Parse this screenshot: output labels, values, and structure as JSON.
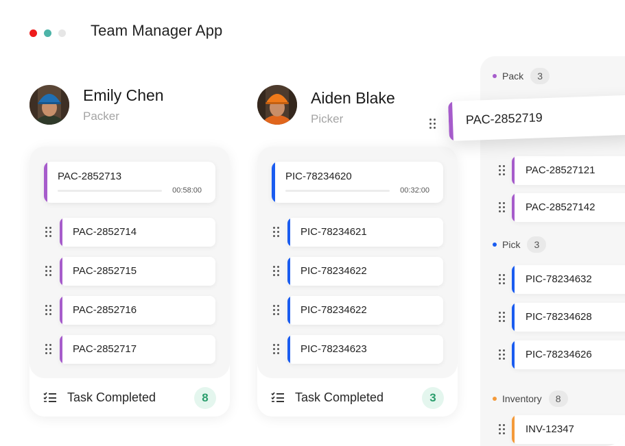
{
  "app": {
    "title": "Team Manager App",
    "window_dots": [
      "#ee1c1c",
      "#4db4a8",
      "#e6e6e6"
    ]
  },
  "colors": {
    "pack": "#a65ccb",
    "pick": "#1a5cf0",
    "inventory": "#f49a3a",
    "completed_badge_bg": "#e4f6ee",
    "completed_badge_text": "#2a9d6c"
  },
  "workers": [
    {
      "name": "Emily Chen",
      "role": "Packer",
      "helmet_color": "#1f6fb3",
      "active_task": {
        "code": "PAC-2852713",
        "time": "00:58:00",
        "progress": 0
      },
      "tasks": [
        "PAC-2852714",
        "PAC-2852715",
        "PAC-2852716",
        "PAC-2852717"
      ],
      "footer_label": "Task Completed",
      "completed_count": "8",
      "accent": "pack"
    },
    {
      "name": "Aiden Blake",
      "role": "Picker",
      "helmet_color": "#f07a1a",
      "active_task": {
        "code": "PIC-78234620",
        "time": "00:32:00",
        "progress": 0
      },
      "tasks": [
        "PIC-78234621",
        "PIC-78234622",
        "PIC-78234622",
        "PIC-78234623"
      ],
      "footer_label": "Task Completed",
      "completed_count": "3",
      "accent": "pick"
    }
  ],
  "dragged_task": {
    "code": "PAC-2852719",
    "accent": "pack"
  },
  "queue": {
    "groups": [
      {
        "name": "Pack",
        "count": "3",
        "color": "#a65ccb",
        "tasks": [
          "PAC-28527121",
          "PAC-28527142"
        ]
      },
      {
        "name": "Pick",
        "count": "3",
        "color": "#1a5cf0",
        "tasks": [
          "PIC-78234632",
          "PIC-78234628",
          "PIC-78234626"
        ]
      },
      {
        "name": "Inventory",
        "count": "8",
        "color": "#f49a3a",
        "tasks": [
          "INV-12347"
        ]
      }
    ]
  }
}
